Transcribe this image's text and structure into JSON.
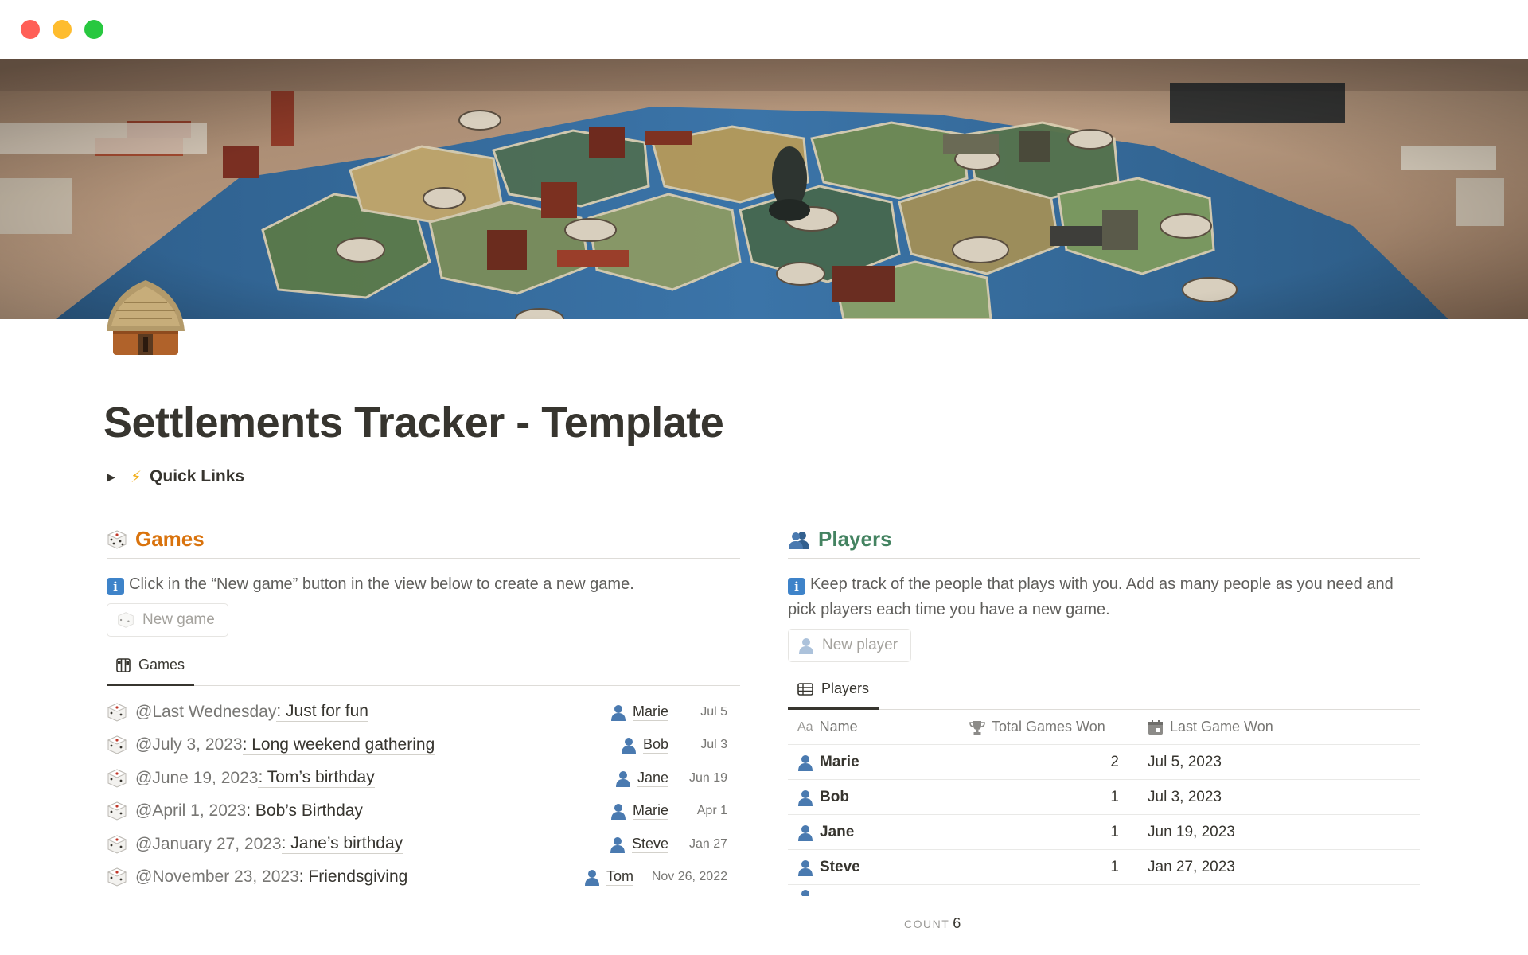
{
  "page": {
    "title": "Settlements Tracker - Template",
    "quick_links": "Quick Links"
  },
  "games": {
    "title": "Games",
    "callout": "Click in the “New game” button in the view below to create a new game.",
    "new_button": "New game",
    "view_tab": "Games",
    "rows": [
      {
        "date": "@Last Wednesday ",
        "title": ": Just for fun",
        "winner": "Marie",
        "short_date": "Jul 5"
      },
      {
        "date": "@July 3, 2023",
        "title": ": Long weekend gathering",
        "winner": "Bob",
        "short_date": "Jul 3"
      },
      {
        "date": "@June 19, 2023",
        "title": ": Tom’s birthday",
        "winner": "Jane",
        "short_date": "Jun 19"
      },
      {
        "date": "@April 1, 2023",
        "title": ": Bob’s Birthday",
        "winner": "Marie",
        "short_date": "Apr 1"
      },
      {
        "date": "@January 27, 2023",
        "title": ": Jane’s birthday",
        "winner": "Steve",
        "short_date": "Jan 27"
      },
      {
        "date": "@November 23, 2023",
        "title": ": Friendsgiving",
        "winner": "Tom",
        "short_date": "Nov 26, 2022"
      }
    ]
  },
  "players": {
    "title": "Players",
    "callout": "Keep track of the people that plays with you. Add as many people as you need and pick players each time you have a new game.",
    "new_button": "New player",
    "view_tab": "Players",
    "columns": {
      "name_prefix": "Aa",
      "name": "Name",
      "won": "Total Games Won",
      "last": "Last Game Won"
    },
    "rows": [
      {
        "name": "Marie",
        "won": "2",
        "last": "Jul 5, 2023"
      },
      {
        "name": "Bob",
        "won": "1",
        "last": "Jul 3, 2023"
      },
      {
        "name": "Jane",
        "won": "1",
        "last": "Jun 19, 2023"
      },
      {
        "name": "Steve",
        "won": "1",
        "last": "Jan 27, 2023"
      }
    ],
    "count_label": "COUNT",
    "count_value": "6"
  },
  "icons": {
    "page_icon": "hut-icon",
    "games": "game-die-icon",
    "players": "busts-in-silhouette-icon",
    "info": "information-icon",
    "person": "bust-in-silhouette-icon",
    "trophy": "trophy-icon",
    "calendar": "calendar-icon",
    "table_view": "table-view-icon",
    "gallery_view": "board-view-icon"
  },
  "colors": {
    "games_heading": "#d9730d",
    "players_heading": "#448361",
    "info_callout": "#3e83c9"
  }
}
